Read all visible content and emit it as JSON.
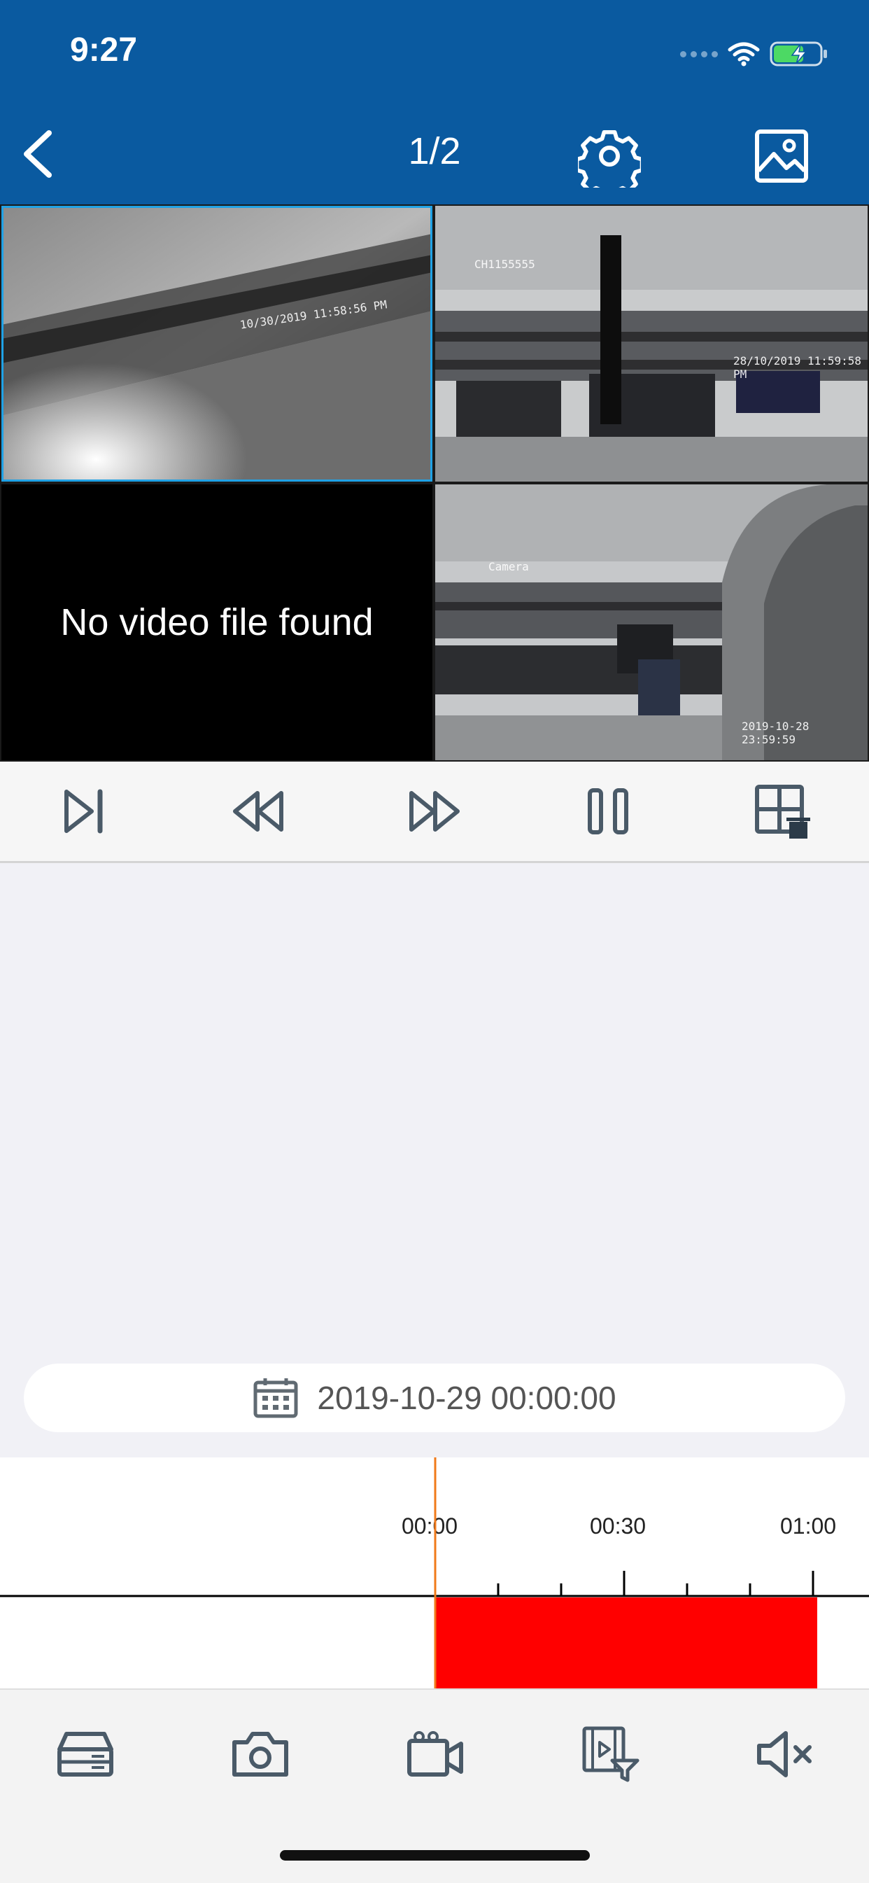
{
  "status_bar": {
    "time": "9:27"
  },
  "header": {
    "page_indicator": "1/2"
  },
  "video_grid": {
    "cells": [
      {
        "osd": "10/30/2019 11:58:56 PM"
      },
      {
        "osd_channel": "CH1155555",
        "osd": "28/10/2019 11:59:58 PM"
      },
      {
        "message": "No video file found"
      },
      {
        "osd_channel": "Camera",
        "osd": "2019-10-28 23:59:59"
      }
    ]
  },
  "controls": {
    "icons": [
      "skip-to-start-icon",
      "rewind-icon",
      "fast-forward-icon",
      "pause-icon",
      "layout-grid-icon"
    ]
  },
  "date_picker": {
    "value": "2019-10-29 00:00:00"
  },
  "timeline": {
    "tick_labels": [
      "00:00",
      "00:30",
      "01:00"
    ],
    "recording_color": "#ff0000",
    "cursor_color": "#f07a1a"
  },
  "toolbar": {
    "icons": [
      "recorder-icon",
      "snapshot-camera-icon",
      "record-video-icon",
      "playback-filter-icon",
      "mute-icon"
    ]
  },
  "colors": {
    "header_bg": "#0a5aa0",
    "accent": "#1fa2e6"
  }
}
